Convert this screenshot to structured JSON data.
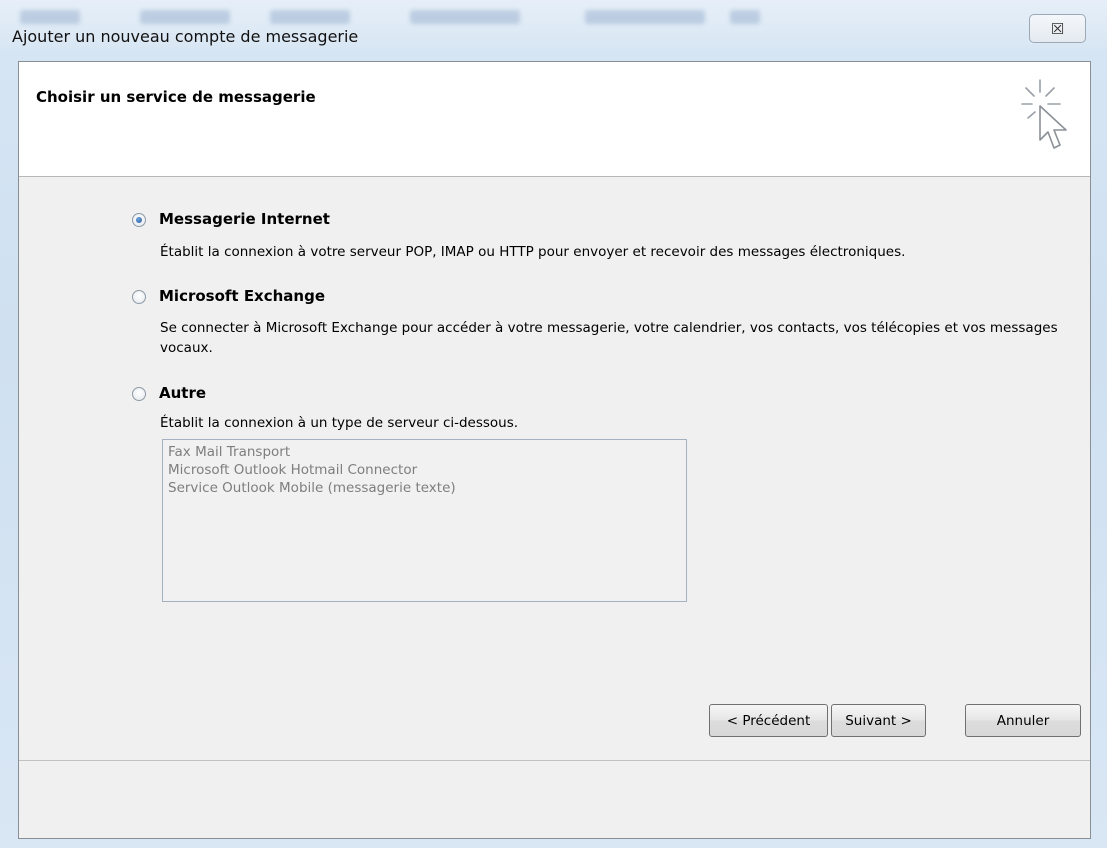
{
  "window": {
    "title": "Ajouter un nouveau compte de messagerie",
    "close_glyph": "☒"
  },
  "header": {
    "title": "Choisir un service de messagerie",
    "icon": "wizard-cursor-icon"
  },
  "options": [
    {
      "label": "Messagerie Internet",
      "description": "Établit la connexion à votre serveur POP, IMAP ou HTTP pour envoyer et recevoir des messages électroniques.",
      "selected": true
    },
    {
      "label": "Microsoft Exchange",
      "description": "Se connecter à Microsoft Exchange pour accéder à votre messagerie, votre calendrier, vos contacts, vos télécopies et vos messages vocaux.",
      "selected": false
    },
    {
      "label": "Autre",
      "description": "Établit la connexion à un type de serveur ci-dessous.",
      "selected": false
    }
  ],
  "server_types": [
    "Fax Mail Transport",
    "Microsoft Outlook Hotmail Connector",
    "Service Outlook Mobile (messagerie texte)"
  ],
  "buttons": {
    "back": "< Précédent",
    "next": "Suivant >",
    "cancel": "Annuler"
  },
  "colors": {
    "dialog_bg": "#f0f0f0",
    "header_bg": "#ffffff",
    "disabled_text": "#7e7e7e"
  }
}
